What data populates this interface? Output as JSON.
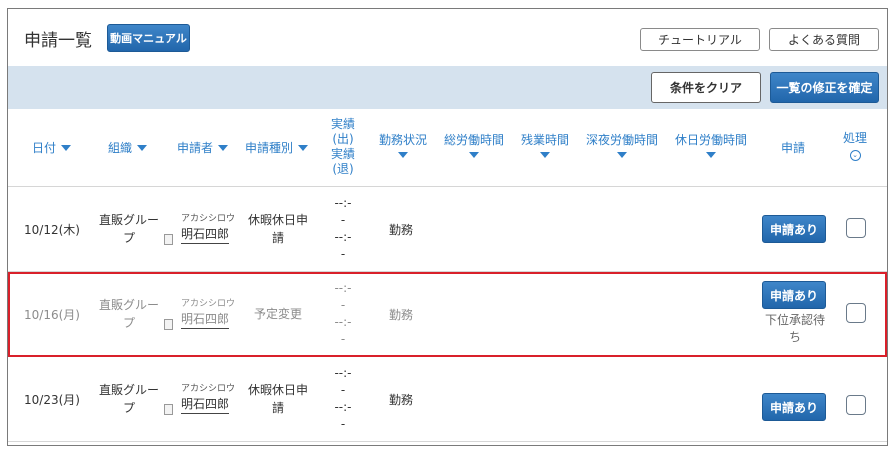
{
  "page": {
    "title": "申請一覧",
    "manual_label": "動画マニュアル",
    "tutorial_label": "チュートリアル",
    "faq_label": "よくある質問",
    "clear_label": "条件をクリア",
    "confirm_label": "一覧の修正を確定"
  },
  "header": {
    "date": "日付",
    "org": "組織",
    "applicant": "申請者",
    "app_type": "申請種別",
    "times_lines": [
      "実績",
      "(出)",
      "実績",
      "(退)"
    ],
    "work_status": "勤務状況",
    "total_work": "総労働時間",
    "overtime": "残業時間",
    "night_work": "深夜労働時間",
    "holiday_work": "休日労働時間",
    "application": "申請",
    "process": "処理"
  },
  "rows": [
    {
      "date": "10/12(木)",
      "org_lines": [
        "直販グルー",
        "プ"
      ],
      "kana": "アカシシロウ",
      "name": "明石四郎",
      "type_lines": [
        "休暇休日申",
        "請"
      ],
      "time_lines": [
        "--:-",
        "-",
        "--:-",
        "-"
      ],
      "work_status": "勤務",
      "app_button": "申請あり",
      "pending_lines": []
    },
    {
      "date": "10/16(月)",
      "org_lines": [
        "直販グルー",
        "プ"
      ],
      "kana": "アカシシロウ",
      "name": "明石四郎",
      "type_lines": [
        "予定変更"
      ],
      "time_lines": [
        "--:-",
        "-",
        "--:-",
        "-"
      ],
      "work_status": "勤務",
      "app_button": "申請あり",
      "pending_lines": [
        "下位承認待",
        "ち"
      ]
    },
    {
      "date": "10/23(月)",
      "org_lines": [
        "直販グルー",
        "プ"
      ],
      "kana": "アカシシロウ",
      "name": "明石四郎",
      "type_lines": [
        "休暇休日申",
        "請"
      ],
      "time_lines": [
        "--:-",
        "-",
        "--:-",
        "-"
      ],
      "work_status": "勤務",
      "app_button": "申請あり",
      "pending_lines": []
    }
  ]
}
